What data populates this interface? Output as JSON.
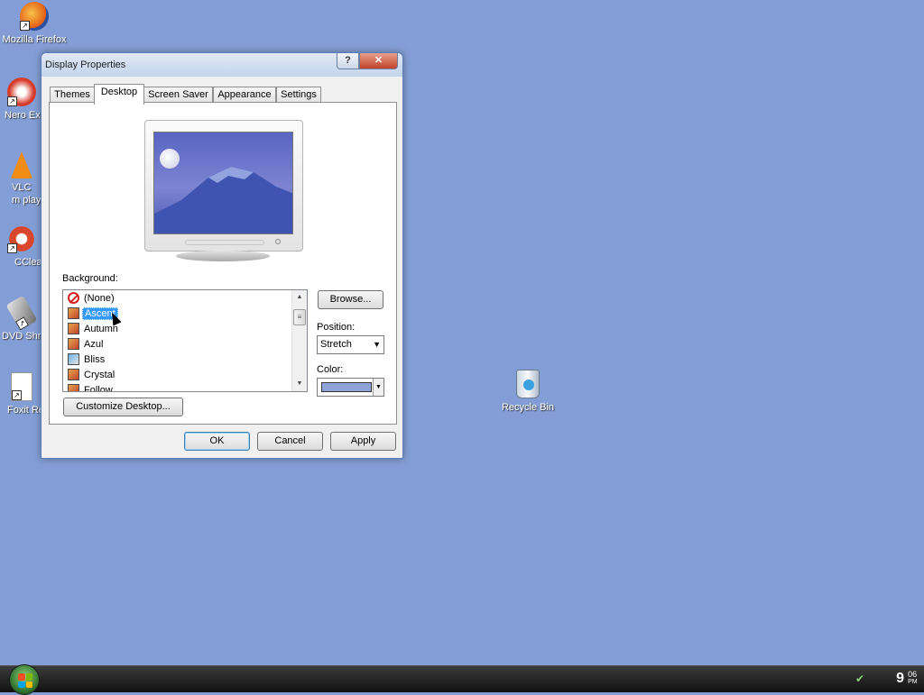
{
  "desktop": {
    "icons": [
      {
        "label": "Mozilla Firefox",
        "icon": "firefox-icon"
      },
      {
        "label": "Nero Ex",
        "icon": "nero-icon"
      },
      {
        "label": "VLC m play",
        "icon": "vlc-icon"
      },
      {
        "label": "CClea",
        "icon": "ccleaner-icon"
      },
      {
        "label": "DVD Shr",
        "icon": "dvd-shrink-icon"
      },
      {
        "label": "Foxit Re",
        "icon": "foxit-reader-icon"
      },
      {
        "label": "Recycle Bin",
        "icon": "recycle-bin-icon"
      }
    ],
    "background_color": "#839ed6"
  },
  "dialog": {
    "title": "Display Properties",
    "help_label": "?",
    "close_label": "✕",
    "tabs": [
      {
        "label": "Themes",
        "active": false
      },
      {
        "label": "Desktop",
        "active": true
      },
      {
        "label": "Screen Saver",
        "active": false
      },
      {
        "label": "Appearance",
        "active": false
      },
      {
        "label": "Settings",
        "active": false
      }
    ],
    "background_label": "Background:",
    "backgrounds": [
      {
        "label": "(None)",
        "icon": "none-icon",
        "selected": false
      },
      {
        "label": "Ascent",
        "icon": "image-icon",
        "selected": true
      },
      {
        "label": "Autumn",
        "icon": "image-icon",
        "selected": false
      },
      {
        "label": "Azul",
        "icon": "image-icon",
        "selected": false
      },
      {
        "label": "Bliss",
        "icon": "image-icon",
        "selected": false
      },
      {
        "label": "Crystal",
        "icon": "image-icon",
        "selected": false
      },
      {
        "label": "Follow",
        "icon": "image-icon",
        "selected": false
      }
    ],
    "browse_label": "Browse...",
    "position_label": "Position:",
    "position_value": "Stretch",
    "color_label": "Color:",
    "color_value": "#8fa3d8",
    "customize_label": "Customize Desktop...",
    "ok_label": "OK",
    "cancel_label": "Cancel",
    "apply_label": "Apply"
  },
  "taskbar": {
    "clock_hour": "9",
    "clock_minutes": "06",
    "clock_ampm": "PM"
  }
}
